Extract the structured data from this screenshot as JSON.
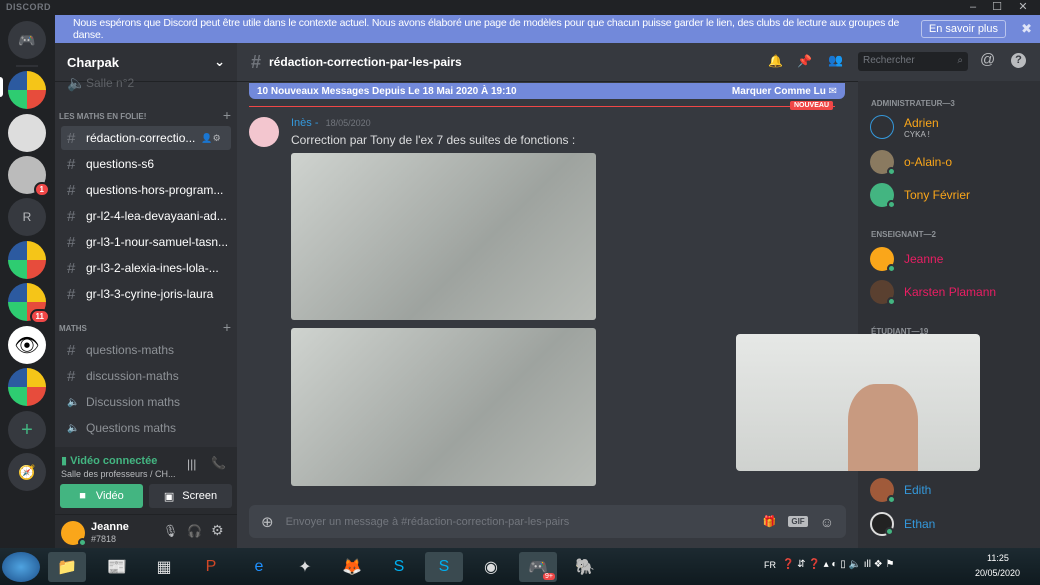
{
  "app": {
    "brand": "DISCORD"
  },
  "banner": {
    "text": "Nous espérons que Discord peut être utile dans le contexte actuel. Nous avons élaboré une page de modèles pour que chacun puisse garder le lien, des clubs de lecture aux groupes de danse.",
    "button": "En savoir plus"
  },
  "servers": [
    {
      "badge": ""
    },
    {
      "badge": ""
    },
    {
      "badge": "1"
    },
    {
      "letter": "R"
    },
    {
      "badge": ""
    },
    {
      "badge": "11"
    },
    {
      "badge": ""
    },
    {
      "badge": ""
    }
  ],
  "guild": {
    "name": "Charpak"
  },
  "channels": {
    "partial": "Salle n°2",
    "categories": [
      {
        "name": "LES MATHS EN FOLIE!",
        "items": [
          "rédaction-correctio...",
          "questions-s6",
          "questions-hors-program...",
          "gr-l2-4-lea-devayaani-ad...",
          "gr-l3-1-nour-samuel-tasn...",
          "gr-l3-2-alexia-ines-lola-...",
          "gr-l3-3-cyrine-joris-laura"
        ]
      },
      {
        "name": "MATHS",
        "items": [
          "questions-maths",
          "discussion-maths",
          "Discussion maths",
          "Questions maths"
        ]
      }
    ]
  },
  "voice": {
    "status": "Vidéo connectée",
    "location": "Salle des professeurs / CH...",
    "video_btn": "Vidéo",
    "screen_btn": "Screen"
  },
  "user": {
    "name": "Jeanne",
    "tag": "#7818"
  },
  "chat": {
    "channel": "rédaction-correction-par-les-pairs",
    "new_messages": "10 Nouveaux Messages Depuis Le 18 Mai 2020 À 19:10",
    "mark_read": "Marquer Comme Lu",
    "new_label": "NOUVEAU",
    "message": {
      "author": "Inès -",
      "date": "18/05/2020",
      "text": "Correction par Tony de l'ex 7 des suites de fonctions :"
    },
    "composer_placeholder": "Envoyer un message à #rédaction-correction-par-les-pairs",
    "search_placeholder": "Rechercher"
  },
  "members": {
    "groups": [
      {
        "title": "ADMINISTRATEUR—3",
        "members": [
          {
            "name": "Adrien",
            "status": "CYKA !",
            "color": "#faa61a"
          },
          {
            "name": "o-Alain-o",
            "color": "#faa61a"
          },
          {
            "name": "Tony Février",
            "color": "#faa61a"
          }
        ]
      },
      {
        "title": "ENSEIGNANT—2",
        "members": [
          {
            "name": "Jeanne",
            "color": "#e91e63"
          },
          {
            "name": "Karsten Plamann",
            "color": "#e91e63"
          }
        ]
      },
      {
        "title": "ÉTUDIANT—19",
        "members": [
          {
            "name": "Edith",
            "color": "#3498db"
          },
          {
            "name": "Ethan",
            "color": "#3498db"
          }
        ]
      }
    ]
  },
  "taskbar": {
    "lang": "FR",
    "time": "11:25",
    "date": "20/05/2020",
    "discord_badge": "9+"
  }
}
